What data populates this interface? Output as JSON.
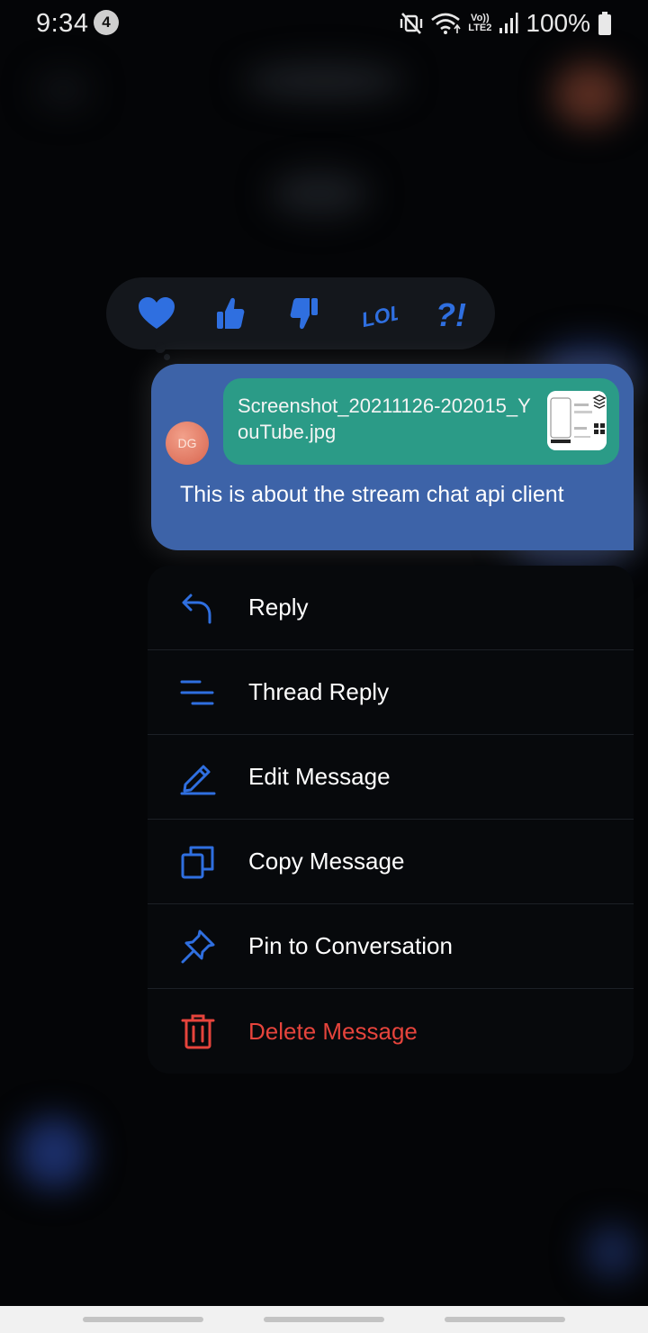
{
  "status_bar": {
    "time": "9:34",
    "notification_count": "4",
    "network_top": "Vo))",
    "network_bottom": "LTE2",
    "battery": "100%"
  },
  "reactions": [
    {
      "name": "love",
      "icon": "heart-icon"
    },
    {
      "name": "like",
      "icon": "thumbs-up-icon"
    },
    {
      "name": "sad",
      "icon": "thumbs-down-icon"
    },
    {
      "name": "haha",
      "icon": "lol-icon",
      "text": "LOL"
    },
    {
      "name": "wow",
      "icon": "question-exclamation-icon",
      "text": "?!"
    }
  ],
  "message": {
    "avatar_initials": "DG",
    "attachment_name": "Screenshot_20211126-202015_YouTube.jpg",
    "text": "This is about the stream chat api client"
  },
  "menu": {
    "items": [
      {
        "label": "Reply",
        "icon": "reply-arrow-icon"
      },
      {
        "label": "Thread Reply",
        "icon": "thread-lines-icon"
      },
      {
        "label": "Edit Message",
        "icon": "pencil-icon"
      },
      {
        "label": "Copy Message",
        "icon": "copy-icon"
      },
      {
        "label": "Pin to Conversation",
        "icon": "pin-icon"
      },
      {
        "label": "Delete Message",
        "icon": "trash-icon"
      }
    ]
  },
  "colors": {
    "accent_blue": "#2f6fe0",
    "bubble": "#3d63a8",
    "attachment": "#2b9b87",
    "danger": "#e6443c",
    "menu_bg": "#07090c"
  }
}
